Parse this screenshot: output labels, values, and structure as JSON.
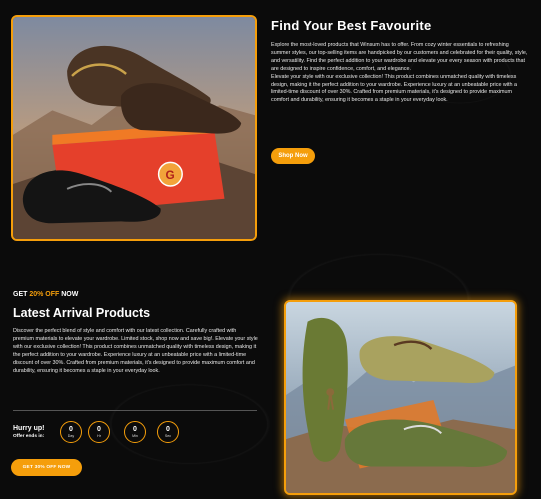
{
  "featured": {
    "title": "Find Your Best Favourite",
    "description": "Explore the most-loved products that Winsum has to offer. From cozy winter essentials to refreshing summer styles, our top-selling items are handpicked by our customers and celebrated for their quality, style, and versatility. Find the perfect addition to your wardrobe and elevate your every season with products that are designed to inspire confidence, comfort, and elegance.",
    "description_2": "Elevate your style with our exclusive collection! This product combines unmatched quality with timeless design, making it the perfect addition to your wardrobe. Experience luxury at an unbeatable price with a limited-time discount of over 30%. Crafted from premium materials, it's designed to provide maximum comfort and durability, ensuring it becomes a staple in your everyday look.",
    "button_label": "Shop Now",
    "image_icon": "loafers-with-shoebox-image"
  },
  "latest": {
    "tag_prefix": "GET",
    "tag_highlight": "20% OFF",
    "tag_suffix": "NOW",
    "title": "Latest Arrival Products",
    "description": "Discover the perfect blend of style and comfort with our latest collection. Carefully crafted with premium materials to elevate your wardrobe. Limited stock, shop now and save big!. Elevate your style with our exclusive collection! This product combines unmatched quality with timeless design, making it the perfect addition to your wardrobe. Experience luxury at an unbeatable price with a limited-time discount of over 30%. Crafted from premium materials, it's designed to provide maximum comfort and durability, ensuring it becomes a staple in your everyday look.",
    "hurry_title": "Hurry up!",
    "hurry_subtitle": "Offer ends in:",
    "countdown": [
      {
        "value": "0",
        "label": "Day"
      },
      {
        "value": "0",
        "label": "Hr"
      },
      {
        "value": "0",
        "label": "Min"
      },
      {
        "value": "0",
        "label": "Sec"
      }
    ],
    "button_label": "GET 30% OFF NOW",
    "image_icon": "green-suede-loafers-image"
  },
  "colors": {
    "accent": "#f59e0b",
    "background": "#0b0b0b"
  }
}
